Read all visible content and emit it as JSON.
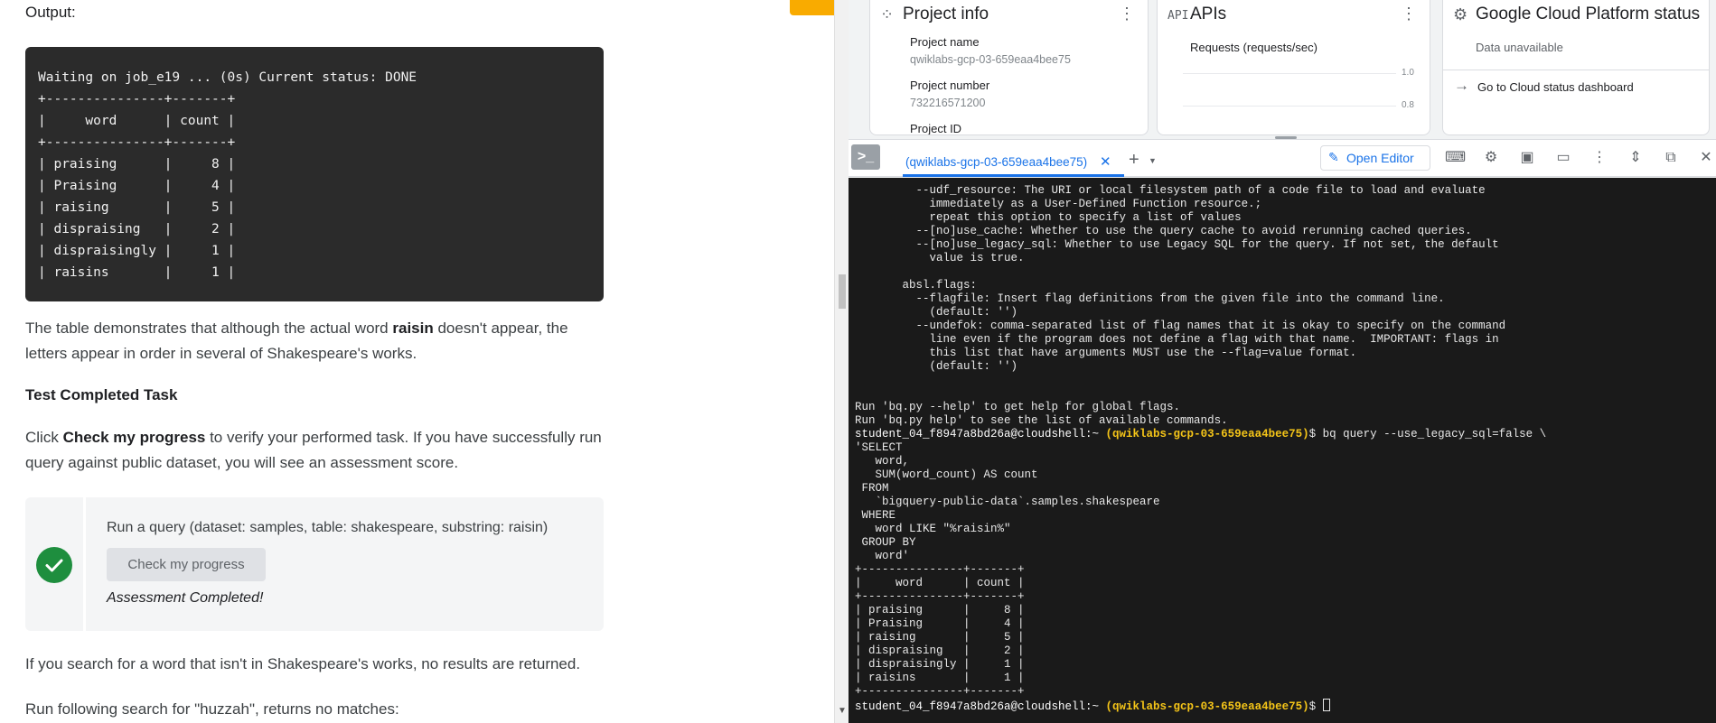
{
  "lab": {
    "output_label": "Output:",
    "code_output": "Waiting on job_e19 ... (0s) Current status: DONE\n+---------------+-------+\n|     word      | count |\n+---------------+-------+\n| praising      |     8 |\n| Praising      |     4 |\n| raising       |     5 |\n| dispraising   |     2 |\n| dispraisingly |     1 |\n| raisins       |     1 |",
    "para1_before": "The table demonstrates that although the actual word ",
    "para1_bold": "raisin",
    "para1_after": " doesn't appear, the letters appear in order in several of Shakespeare's works.",
    "test_heading": "Test Completed Task",
    "para2_before": "Click ",
    "para2_bold": "Check my progress",
    "para2_after": " to verify your performed task. If you have successfully run query against public dataset, you will see an assessment score.",
    "task_title": "Run a query (dataset: samples, table: shakespeare, substring: raisin)",
    "check_button": "Check my progress",
    "assessment": "Assessment Completed!",
    "para3": "If you search for a word that isn't in Shakespeare's works, no results are returned.",
    "para4": "Run following search for \"huzzah\", returns no matches:"
  },
  "console": {
    "project_info": {
      "title": "Project info",
      "name_label": "Project name",
      "name_value": "qwiklabs-gcp-03-659eaa4bee75",
      "number_label": "Project number",
      "number_value": "732216571200",
      "id_label": "Project ID"
    },
    "apis": {
      "icon_text": "API",
      "title": "APIs",
      "subtitle": "Requests (requests/sec)",
      "tick_high": "1.0",
      "tick_low": "0.8"
    },
    "status": {
      "title": "Google Cloud Platform status",
      "subtitle": "Data unavailable",
      "link": "Go to Cloud status dashboard"
    }
  },
  "shell": {
    "tab_label": "(qwiklabs-gcp-03-659eaa4bee75)",
    "open_editor": "Open Editor",
    "help_text": "         --udf_resource: The URI or local filesystem path of a code file to load and evaluate\n           immediately as a User-Defined Function resource.;\n           repeat this option to specify a list of values\n         --[no]use_cache: Whether to use the query cache to avoid rerunning cached queries.\n         --[no]use_legacy_sql: Whether to use Legacy SQL for the query. If not set, the default\n           value is true.\n\n       absl.flags:\n         --flagfile: Insert flag definitions from the given file into the command line.\n           (default: '')\n         --undefok: comma-separated list of flag names that it is okay to specify on the command\n           line even if the program does not define a flag with that name.  IMPORTANT: flags in\n           this list that have arguments MUST use the --flag=value format.\n           (default: '')\n\n\nRun 'bq.py --help' to get help for global flags.\nRun 'bq.py help' to see the list of available commands.",
    "prompt_user": "student_04_f8947a8bd26a@cloudshell:~ ",
    "prompt_project": "(qwiklabs-gcp-03-659eaa4bee75)",
    "command": "$ bq query --use_legacy_sql=false \\",
    "query_and_result": "'SELECT\n   word,\n   SUM(word_count) AS count\n FROM\n   `bigquery-public-data`.samples.shakespeare\n WHERE\n   word LIKE \"%raisin%\"\n GROUP BY\n   word'\n+---------------+-------+\n|     word      | count |\n+---------------+-------+\n| praising      |     8 |\n| Praising      |     4 |\n| raising       |     5 |\n| dispraising   |     2 |\n| dispraisingly |     1 |\n| raisins       |     1 |\n+---------------+-------+",
    "final_prompt_user": "student_04_f8947a8bd26a@cloudshell:~ ",
    "final_prompt_project": "(qwiklabs-gcp-03-659eaa4bee75)",
    "final_prompt_dollar": "$ "
  }
}
